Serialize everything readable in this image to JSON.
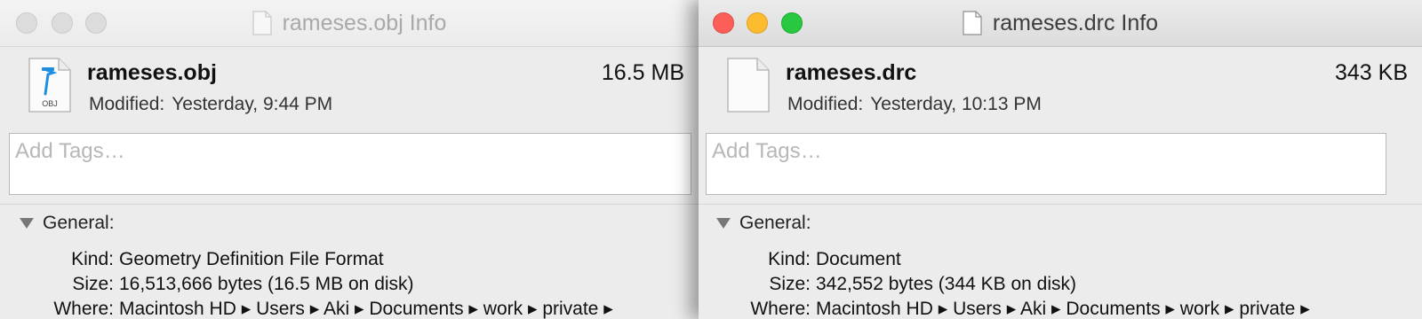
{
  "left_window": {
    "title": "rameses.obj Info",
    "file_name": "rameses.obj",
    "file_size": "16.5 MB",
    "modified_label": "Modified:",
    "modified_value": "Yesterday, 9:44 PM",
    "icon_label": "OBJ",
    "tags_placeholder": "Add Tags…",
    "section_label": "General:",
    "kind_label": "Kind:",
    "kind_value": "Geometry Definition File Format",
    "size_label": "Size:",
    "size_value": "16,513,666 bytes (16.5 MB on disk)",
    "where_label": "Where:",
    "where_value": "Macintosh HD ▸ Users ▸ Aki ▸ Documents ▸ work ▸ private ▸"
  },
  "right_window": {
    "title": "rameses.drc Info",
    "file_name": "rameses.drc",
    "file_size": "343 KB",
    "modified_label": "Modified:",
    "modified_value": "Yesterday, 10:13 PM",
    "tags_placeholder": "Add Tags…",
    "section_label": "General:",
    "kind_label": "Kind:",
    "kind_value": "Document",
    "size_label": "Size:",
    "size_value": "342,552 bytes (344 KB on disk)",
    "where_label": "Where:",
    "where_value": "Macintosh HD ▸ Users ▸ Aki ▸ Documents ▸ work ▸ private ▸"
  },
  "colors": {
    "desktop": "#5f9ea7",
    "close": "#fc5f57",
    "minimize": "#fdbb2e",
    "zoom": "#28c840"
  },
  "icons": [
    "document-icon",
    "xcode-obj-file-icon",
    "disclosure-triangle-icon"
  ]
}
